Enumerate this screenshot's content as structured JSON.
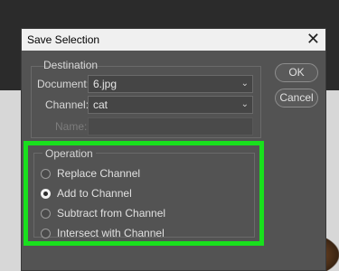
{
  "dialog": {
    "title": "Save Selection",
    "close_glyph": "✕"
  },
  "destination": {
    "legend": "Destination",
    "document_label": "Document:",
    "document_value": "6.jpg",
    "channel_label": "Channel:",
    "channel_value": "cat",
    "name_label": "Name:",
    "name_value": ""
  },
  "buttons": {
    "ok": "OK",
    "cancel": "Cancel"
  },
  "operation": {
    "legend": "Operation",
    "options": [
      {
        "label": "Replace Channel",
        "checked": false
      },
      {
        "label": "Add to Channel",
        "checked": true
      },
      {
        "label": "Subtract from Channel",
        "checked": false
      },
      {
        "label": "Intersect with Channel",
        "checked": false
      }
    ]
  },
  "colors": {
    "highlight": "#19e01d",
    "dialog_bg": "#535353"
  },
  "icons": {
    "dropdown": "chevron-down-icon",
    "close": "close-icon"
  }
}
